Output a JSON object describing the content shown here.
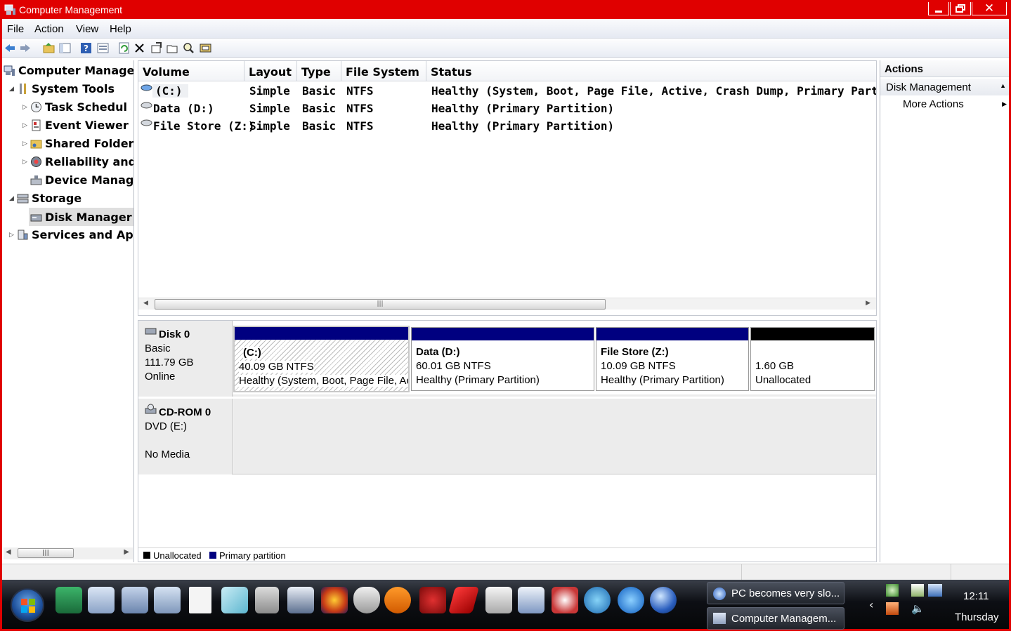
{
  "window": {
    "title": "Computer Management",
    "buttons": [
      "minimize",
      "restore",
      "close"
    ]
  },
  "menu": [
    "File",
    "Action",
    "View",
    "Help"
  ],
  "toolbar_icons": [
    "back-arrow-icon",
    "forward-arrow-icon",
    "up-folder-icon",
    "show-hide-tree-icon",
    "help-icon",
    "properties-icon",
    "refresh-icon",
    "delete-icon",
    "export-icon",
    "open-icon",
    "search-icon",
    "disk-icon"
  ],
  "tree": [
    {
      "label": "Computer Manage",
      "icon": "computer-icon",
      "level": 0,
      "expander": ""
    },
    {
      "label": "System Tools",
      "icon": "tools-icon",
      "level": 1,
      "expander": "◢"
    },
    {
      "label": "Task Schedul",
      "icon": "clock-icon",
      "level": 2,
      "expander": "▷"
    },
    {
      "label": "Event Viewer",
      "icon": "event-log-icon",
      "level": 2,
      "expander": "▷"
    },
    {
      "label": "Shared Folder",
      "icon": "shared-folder-icon",
      "level": 2,
      "expander": "▷"
    },
    {
      "label": "Reliability and",
      "icon": "reliability-icon",
      "level": 2,
      "expander": "▷"
    },
    {
      "label": "Device Manag",
      "icon": "device-manager-icon",
      "level": 2,
      "expander": ""
    },
    {
      "label": "Storage",
      "icon": "storage-icon",
      "level": 1,
      "expander": "◢"
    },
    {
      "label": "Disk Manager",
      "icon": "disk-management-icon",
      "level": 2,
      "expander": "",
      "selected": true
    },
    {
      "label": "Services and Ap",
      "icon": "services-icon",
      "level": 1,
      "expander": "▷"
    }
  ],
  "volumes": {
    "headers": [
      "Volume",
      "Layout",
      "Type",
      "File System",
      "Status"
    ],
    "rows": [
      {
        "volume": "(C:)",
        "layout": "Simple",
        "type": "Basic",
        "fs": "NTFS",
        "status": "Healthy (System, Boot, Page File, Active, Crash Dump, Primary Parti"
      },
      {
        "volume": "Data (D:)",
        "layout": "Simple",
        "type": "Basic",
        "fs": "NTFS",
        "status": "Healthy (Primary Partition)"
      },
      {
        "volume": "File Store (Z:)",
        "layout": "Simple",
        "type": "Basic",
        "fs": "NTFS",
        "status": "Healthy (Primary Partition)"
      }
    ]
  },
  "disks": [
    {
      "name": "Disk 0",
      "kind": "Basic",
      "size": "111.79 GB",
      "state": "Online",
      "partitions": [
        {
          "name": "(C:)",
          "size": "40.09 GB NTFS",
          "status": "Healthy (System, Boot, Page File, Ac",
          "kind": "primary",
          "selected": true
        },
        {
          "name": "Data  (D:)",
          "size": "60.01 GB NTFS",
          "status": "Healthy (Primary Partition)",
          "kind": "primary"
        },
        {
          "name": "File Store  (Z:)",
          "size": "10.09 GB NTFS",
          "status": "Healthy (Primary Partition)",
          "kind": "primary"
        },
        {
          "name": "",
          "size": "1.60 GB",
          "status": "Unallocated",
          "kind": "unallocated"
        }
      ]
    },
    {
      "name": "CD-ROM 0",
      "kind": "DVD (E:)",
      "size": "",
      "state": "No Media"
    }
  ],
  "legend": [
    {
      "label": "Unallocated",
      "color": "#000000"
    },
    {
      "label": "Primary partition",
      "color": "#000080"
    }
  ],
  "actions": {
    "title": "Actions",
    "section": "Disk Management",
    "items": [
      "More Actions"
    ]
  },
  "taskbar": {
    "tasks": [
      "PC becomes very slo...",
      "Computer Managem..."
    ],
    "clock": {
      "time": "12:11",
      "day": "Thursday"
    }
  },
  "colors": {
    "accent_red": "#e00000",
    "primary_partition": "#000080",
    "unallocated": "#000000"
  }
}
